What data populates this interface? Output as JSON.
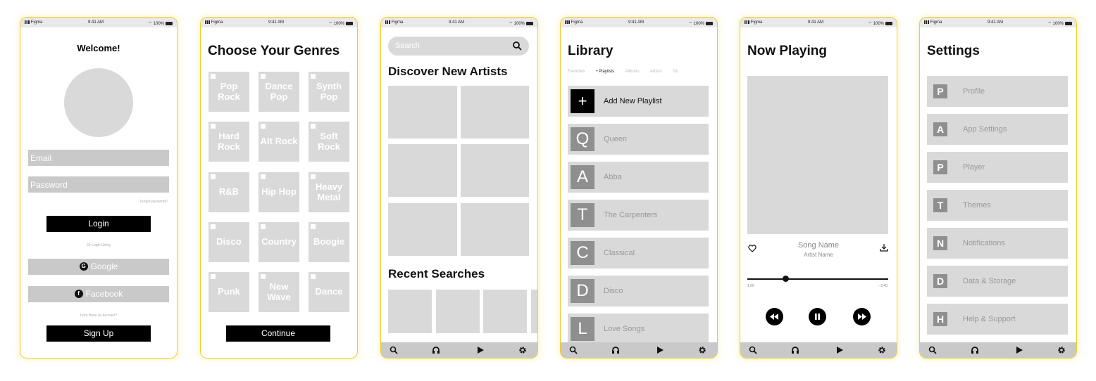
{
  "status": {
    "carrier": "Figma",
    "time": "9:41 AM",
    "battery": "100%"
  },
  "welcome": {
    "title": "Welcome!",
    "email_placeholder": "Email",
    "password_placeholder": "Password",
    "forgot": "Forgot password?",
    "login": "Login",
    "or_login": "Or Login Using",
    "google": "Google",
    "facebook": "Facebook",
    "no_account": "Dont Have an Account?",
    "signup": "Sign Up"
  },
  "genres": {
    "title": "Choose Your Genres",
    "items": [
      "Pop Rock",
      "Dance Pop",
      "Synth Pop",
      "Hard Rock",
      "Alt Rock",
      "Soft Rock",
      "R&B",
      "Hip Hop",
      "Heavy Metal",
      "Disco",
      "Country",
      "Boogie",
      "Punk",
      "New Wave",
      "Dance"
    ],
    "continue": "Continue"
  },
  "discover": {
    "search_placeholder": "Search",
    "title": "Discover New Artists",
    "recent": "Recent Searches"
  },
  "library": {
    "title": "Library",
    "tabs": [
      "Favorites",
      "• Playlists",
      "Albums",
      "Artists",
      "Do"
    ],
    "add": "Add New Playlist",
    "playlists": [
      {
        "letter": "Q",
        "name": "Queen"
      },
      {
        "letter": "A",
        "name": "Abba"
      },
      {
        "letter": "T",
        "name": "The Carpenters"
      },
      {
        "letter": "C",
        "name": "Classical"
      },
      {
        "letter": "D",
        "name": "Disco"
      },
      {
        "letter": "L",
        "name": "Love Songs"
      }
    ]
  },
  "now_playing": {
    "title": "Now Playing",
    "song": "Song Name",
    "artist": "Artist Name",
    "elapsed": "1:60",
    "remaining": "- 2:40",
    "progress": 0.27
  },
  "settings": {
    "title": "Settings",
    "items": [
      {
        "letter": "P",
        "label": "Profile"
      },
      {
        "letter": "A",
        "label": "App Settings"
      },
      {
        "letter": "P",
        "label": "Player"
      },
      {
        "letter": "T",
        "label": "Themes"
      },
      {
        "letter": "N",
        "label": "Notifications"
      },
      {
        "letter": "D",
        "label": "Data & Storage"
      },
      {
        "letter": "H",
        "label": "Help & Support"
      }
    ]
  }
}
